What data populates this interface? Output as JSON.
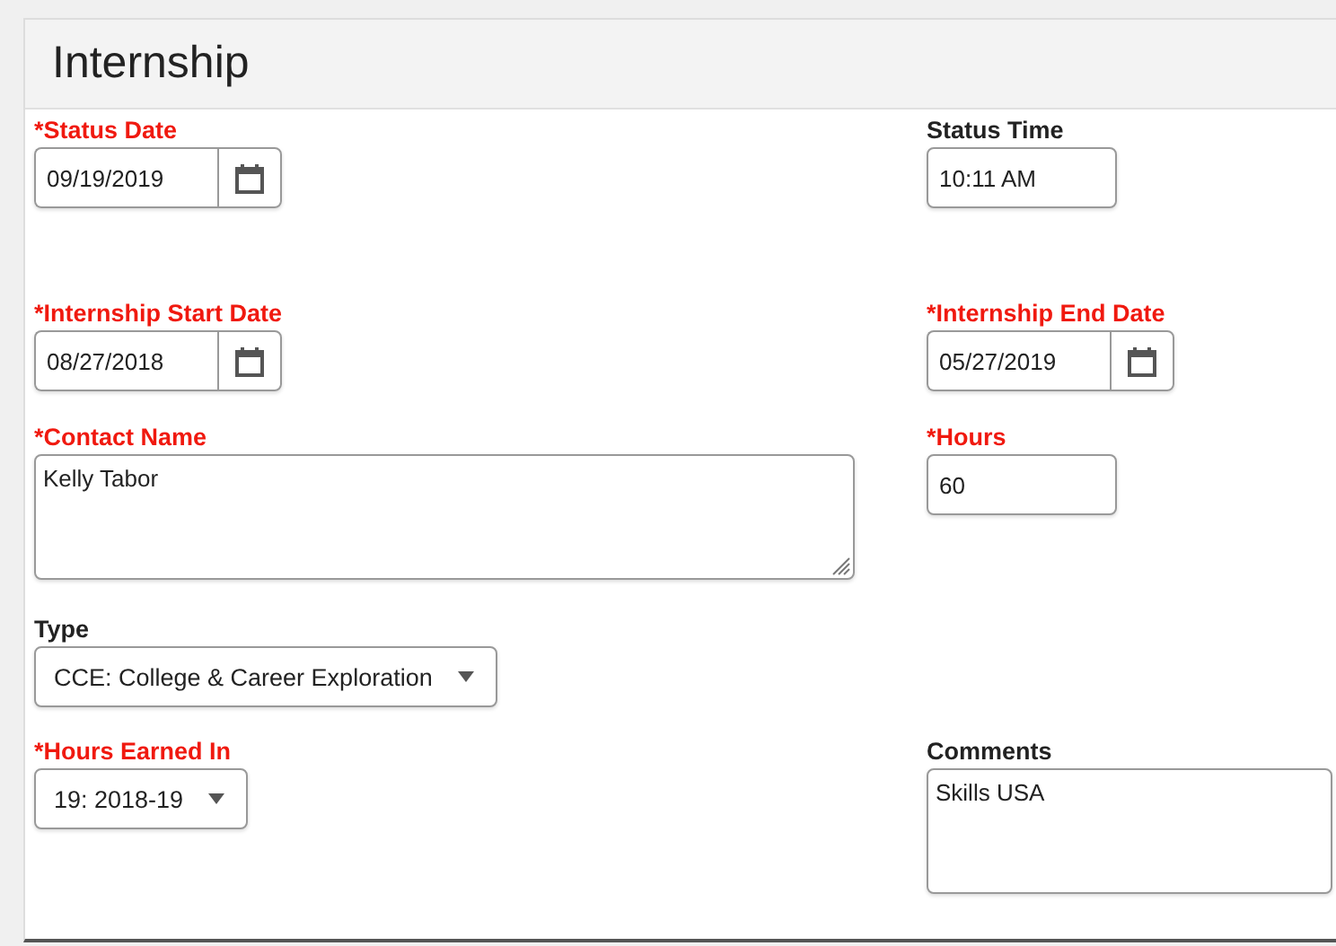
{
  "panel": {
    "title": "Internship"
  },
  "rows": [
    {
      "fields": [
        {
          "kind": "date",
          "label": "*Status Date",
          "required": true,
          "value": "09/19/2019"
        },
        {
          "kind": "time",
          "label": "Status Time",
          "required": false,
          "value": "10:11 AM"
        }
      ]
    },
    {
      "fields": [
        {
          "kind": "date",
          "label": "*Internship Start Date",
          "required": true,
          "value": "08/27/2018"
        },
        {
          "kind": "date",
          "label": "*Internship End Date",
          "required": true,
          "value": "05/27/2019"
        }
      ]
    },
    {
      "fields": [
        {
          "kind": "textarea",
          "label": "*Contact Name",
          "required": true,
          "value": "Kelly Tabor"
        },
        {
          "kind": "text",
          "label": "*Hours",
          "required": true,
          "value": "60"
        }
      ]
    },
    {
      "fields": [
        {
          "kind": "select",
          "label": "Type",
          "required": false,
          "value": "CCE: College & Career Exploration"
        }
      ]
    },
    {
      "fields": [
        {
          "kind": "select-short",
          "label": "*Hours Earned In",
          "required": true,
          "value": "19: 2018-19"
        },
        {
          "kind": "textarea-wide",
          "label": "Comments",
          "required": false,
          "value": "Skills USA"
        }
      ]
    }
  ]
}
